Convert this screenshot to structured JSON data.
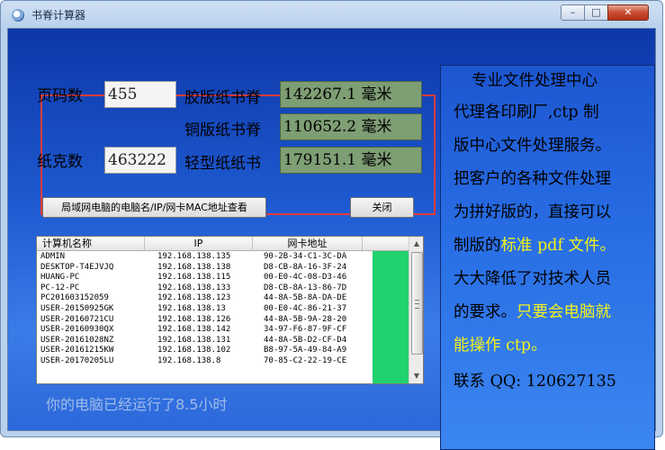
{
  "window": {
    "title": "书脊计算器",
    "controls": {
      "minimize": "–",
      "maximize": "□",
      "close": "✕"
    }
  },
  "form": {
    "pages_label": "页码数",
    "pages_value": "455",
    "weight_label": "纸克数",
    "weight_value": "463222",
    "results": [
      {
        "label": "胶版纸书脊",
        "value": "142267.1 毫米"
      },
      {
        "label": "铜版纸书脊",
        "value": "110652.2 毫米"
      },
      {
        "label": "轻型纸纸书",
        "value": "179151.1 毫米"
      }
    ]
  },
  "buttons": {
    "lookup": "局域网电脑的电脑名/IP/网卡MAC地址查看",
    "close": "关闭"
  },
  "list": {
    "columns": [
      "计算机名称",
      "IP",
      "网卡地址"
    ],
    "rows": [
      [
        "ADMIN",
        "192.168.138.135",
        "90-2B-34-C1-3C-DA"
      ],
      [
        "DESKTOP-T4EJVJQ",
        "192.168.138.138",
        "D8-CB-8A-16-3F-24"
      ],
      [
        "HUANG-PC",
        "192.168.138.115",
        "00-E0-4C-08-D3-46"
      ],
      [
        "PC-12-PC",
        "192.168.138.133",
        "D8-CB-8A-13-86-7D"
      ],
      [
        "PC201603152059",
        "192.168.138.123",
        "44-8A-5B-8A-DA-DE"
      ],
      [
        "USER-20150925GK",
        "192.168.138.13",
        "00-E0-4C-86-21-37"
      ],
      [
        "USER-20160721CU",
        "192.168.138.126",
        "44-8A-5B-9A-28-20"
      ],
      [
        "USER-20160930QX",
        "192.168.138.142",
        "34-97-F6-87-9F-CF"
      ],
      [
        "USER-20161028NZ",
        "192.168.138.131",
        "44-8A-5B-D2-CF-D4"
      ],
      [
        "USER-20161215KW",
        "192.168.138.102",
        "B8-97-5A-49-84-A9"
      ],
      [
        "USER-20170205LU",
        "192.168.138.8",
        "70-85-C2-22-19-CE"
      ]
    ]
  },
  "runtime_text": "你的电脑已经运行了8.5小时",
  "ad": {
    "heading": "专业文件处理中心",
    "line1": "代理各印刷厂,ctp 制",
    "line2": "版中心文件处理服务。",
    "line3": "把客户的各种文件处理",
    "line4": "为拼好版的，直接可以",
    "line5_black": "制版的",
    "line5_yellow": "标准 pdf 文件。",
    "line6": "大大降低了对技术人员",
    "line7_black": "的要求。",
    "line7_yellow": "只要会电脑就",
    "line8": "能操作 ctp。",
    "contact": "联系 QQ: 120627135"
  },
  "colors": {
    "highlight_box": "#e23b3b",
    "result_bg": "#7e9e74",
    "ad_yellow": "#f2f21e",
    "list_green": "#22d26e"
  }
}
